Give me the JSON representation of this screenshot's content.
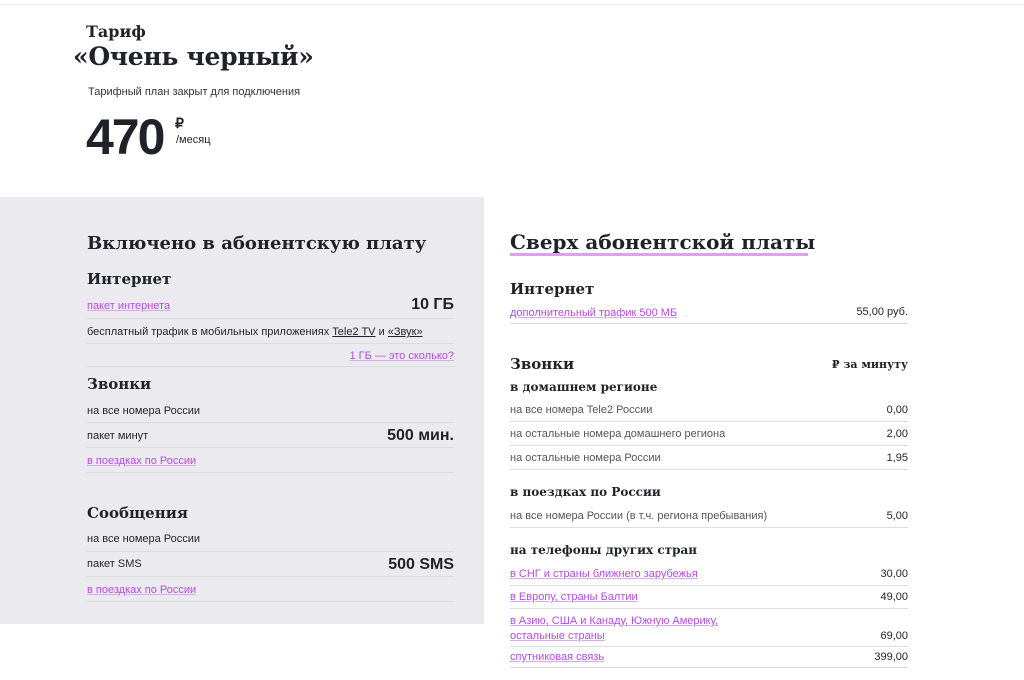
{
  "header": {
    "label": "Тариф",
    "name": "«Очень черный»",
    "closed_note": "Тарифный план закрыт для подключения",
    "price": "470",
    "currency": "₽",
    "period": "/месяц"
  },
  "included": {
    "title": "Включено в абонентскую плату",
    "internet": {
      "title": "Интернет",
      "package_link": "пакет интернета",
      "package_value": "10 ГБ",
      "free_traffic_text": "бесплатный трафик в мобильных приложениях",
      "app1": "Tele2 TV",
      "and": "и",
      "app2": "«Звук»",
      "gb_link": "1 ГБ — это сколько?"
    },
    "calls": {
      "title": "Звонки",
      "all_numbers": "на все номера России",
      "package_label": "пакет минут",
      "package_value": "500 мин.",
      "trips_link": "в поездках по России"
    },
    "sms": {
      "title": "Сообщения",
      "all_numbers": "на все номера России",
      "package_label": "пакет SMS",
      "package_value": "500 SMS",
      "trips_link": "в поездках по России"
    }
  },
  "extra": {
    "title": "Сверх абонентской платы",
    "internet": {
      "title": "Интернет",
      "row_label": "дополнительный трафик 500 МБ",
      "row_value": "55,00 руб."
    },
    "calls": {
      "title": "Звонки",
      "unit": "₽ за минуту",
      "home_title": "в домашнем регионе",
      "home_rows": [
        {
          "label": "на все номера Tele2 России",
          "value": "0,00"
        },
        {
          "label": "на остальные номера домашнего региона",
          "value": "2,00"
        },
        {
          "label": "на остальные номера России",
          "value": "1,95"
        }
      ],
      "trips_title": "в поездках по России",
      "trips_rows": [
        {
          "label": "на все номера России (в т.ч. региона пребывания)",
          "value": "5,00"
        }
      ],
      "intl_title": "на телефоны других стран",
      "intl_rows": [
        {
          "label": "в СНГ и страны ближнего зарубежья",
          "value": "30,00"
        },
        {
          "label": "в Европу, страны Балтии",
          "value": "49,00"
        },
        {
          "label_line1": "в Азию, США и Канаду, Южную Америку,",
          "label_line2": "остальные страны",
          "value": "69,00"
        },
        {
          "label": "спутниковая связь",
          "value": "399,00"
        }
      ]
    }
  }
}
